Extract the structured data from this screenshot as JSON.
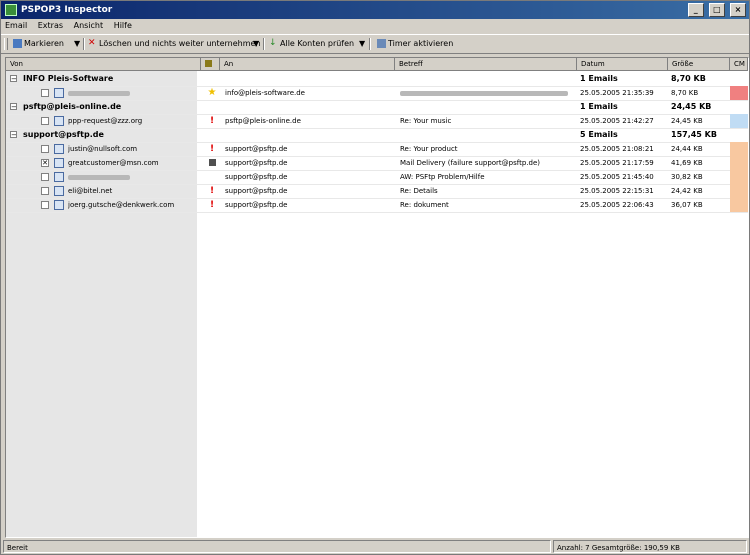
{
  "window": {
    "title": "PSPOP3 Inspector",
    "minimize": "_",
    "maximize": "□",
    "close": "×"
  },
  "menu": [
    "Email",
    "Extras",
    "Ansicht",
    "Hilfe"
  ],
  "toolbar": {
    "mark": "Markieren",
    "delete": "Löschen und nichts weiter unternehmen",
    "check_all": "Alle Konten prüfen",
    "timer": "Timer aktivieren"
  },
  "columns": [
    "Von",
    "",
    "An",
    "Betreff",
    "Datum",
    "Größe",
    "CM"
  ],
  "groups": [
    {
      "name": "INFO Pleis-Software",
      "summary": "1 Emails",
      "size": "8,70 KB",
      "mails": [
        {
          "from": "",
          "flag": "star",
          "to": "info@pleis-software.de",
          "subject": "",
          "date": "25.05.2005 21:35:39",
          "size": "8,70 KB",
          "checked": false,
          "cm_color": "#f08080"
        }
      ]
    },
    {
      "name": "psftp@pleis-online.de",
      "summary": "1 Emails",
      "size": "24,45 KB",
      "mails": [
        {
          "from": "ppp-request@zzz.org",
          "flag": "excl",
          "to": "psftp@pleis-online.de",
          "subject": "Re: Your music",
          "date": "25.05.2005 21:42:27",
          "size": "24,45 KB",
          "checked": false,
          "cm_color": "#c0dcf4"
        }
      ]
    },
    {
      "name": "support@psftp.de",
      "summary": "5 Emails",
      "size": "157,45 KB",
      "mails": [
        {
          "from": "justin@nullsoft.com",
          "flag": "excl",
          "to": "support@psftp.de",
          "subject": "Re: Your product",
          "date": "25.05.2005 21:08:21",
          "size": "24,44 KB",
          "checked": false,
          "cm_color": "#f8c8a0"
        },
        {
          "from": "greatcustomer@msn.com",
          "flag": "square",
          "to": "support@psftp.de",
          "subject": "Mail Delivery (failure support@psftp.de)",
          "date": "25.05.2005 21:17:59",
          "size": "41,69 KB",
          "checked": true,
          "cm_color": "#f8c8a0"
        },
        {
          "from": "",
          "flag": "",
          "to": "support@psftp.de",
          "subject": "AW: PSFtp Problem/Hilfe",
          "date": "25.05.2005 21:45:40",
          "size": "30,82 KB",
          "checked": false,
          "cm_color": "#f8c8a0"
        },
        {
          "from": "eli@bitel.net",
          "flag": "excl",
          "to": "support@psftp.de",
          "subject": "Re: Details",
          "date": "25.05.2005 22:15:31",
          "size": "24,42 KB",
          "checked": false,
          "cm_color": "#f8c8a0"
        },
        {
          "from": "joerg.gutsche@denkwerk.com",
          "flag": "excl",
          "to": "support@psftp.de",
          "subject": "Re: dokument",
          "date": "25.05.2005 22:06:43",
          "size": "36,07 KB",
          "checked": false,
          "cm_color": "#f8c8a0"
        }
      ]
    }
  ],
  "status": {
    "left": "Bereit",
    "right": "Anzahl: 7 Gesamtgröße: 190,59 KB"
  },
  "colors": {
    "title_start": "#0a246a",
    "title_end": "#3a6ea5",
    "flag_red": "#e00000",
    "flag_star": "#f0c000"
  }
}
